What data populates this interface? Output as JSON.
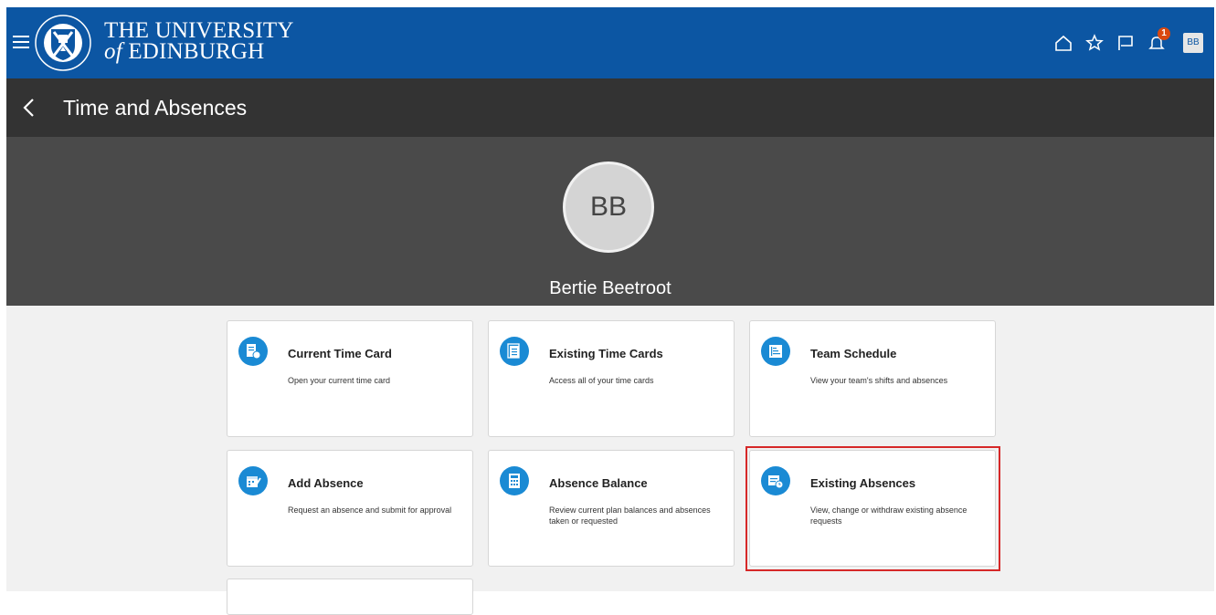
{
  "header": {
    "university_line1": "THE UNIVERSITY",
    "university_line2_prefix": "of",
    "university_line2": "EDINBURGH",
    "notification_count": "1",
    "user_initials": "BB",
    "brand_color": "#0c56a3"
  },
  "titlebar": {
    "title": "Time and Absences"
  },
  "profile": {
    "initials": "BB",
    "name": "Bertie Beetroot"
  },
  "tiles": [
    {
      "title": "Current Time Card",
      "description": "Open your current time card",
      "icon": "time-card-icon"
    },
    {
      "title": "Existing Time Cards",
      "description": "Access all of your time cards",
      "icon": "time-cards-icon"
    },
    {
      "title": "Team Schedule",
      "description": "View your team's shifts and absences",
      "icon": "schedule-icon"
    },
    {
      "title": "Add Absence",
      "description": "Request an absence and submit for approval",
      "icon": "add-absence-icon"
    },
    {
      "title": "Absence Balance",
      "description": "Review current plan balances and absences taken or requested",
      "icon": "calculator-icon"
    },
    {
      "title": "Existing Absences",
      "description": "View, change or withdraw existing absence requests",
      "icon": "existing-absences-icon"
    }
  ],
  "colors": {
    "accent": "#1a8ad4",
    "highlight": "#d62828"
  }
}
